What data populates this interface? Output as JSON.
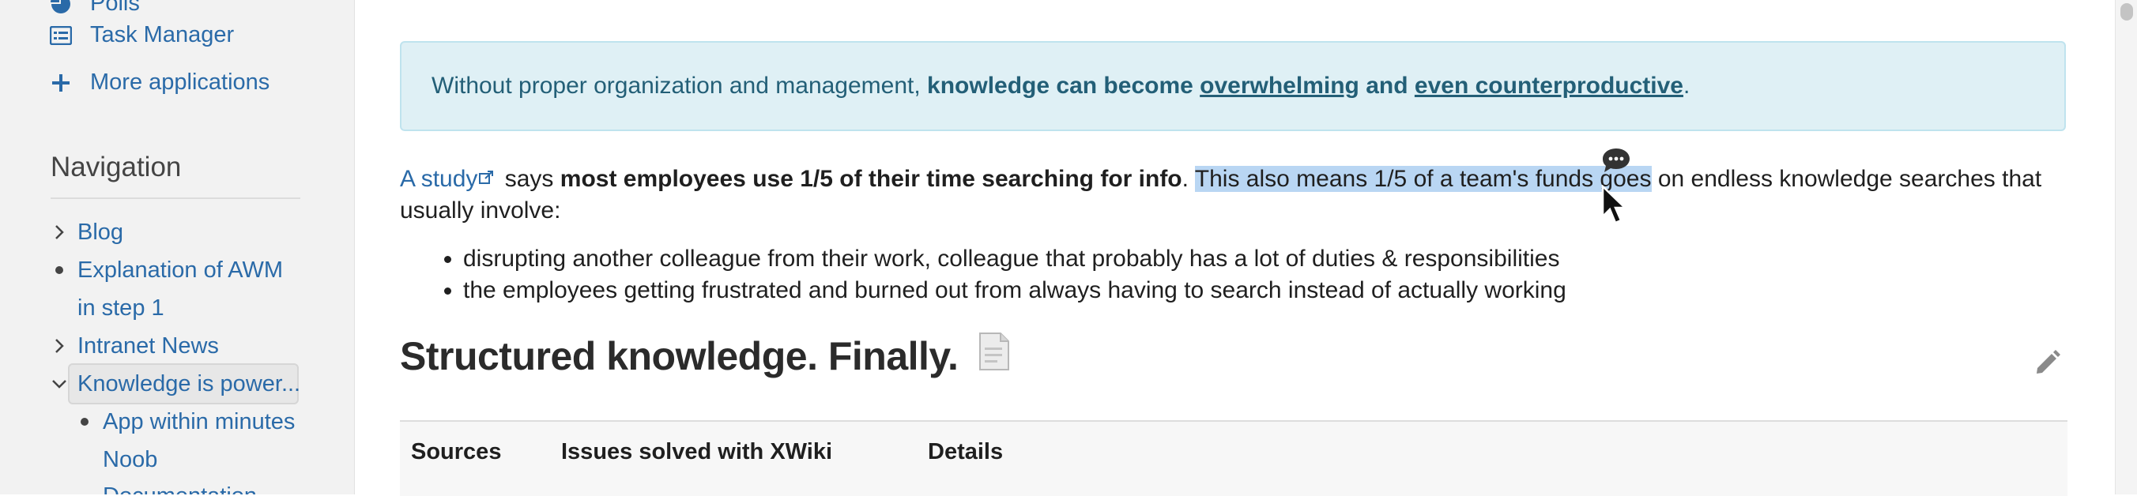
{
  "sidebar": {
    "apps": [
      {
        "label": "Polls",
        "icon": "pie-chart-icon"
      },
      {
        "label": "Task Manager",
        "icon": "list-icon"
      }
    ],
    "more_apps": {
      "label": "More applications",
      "icon": "plus-icon"
    },
    "nav_heading": "Navigation",
    "nav_items": {
      "blog": "Blog",
      "awm_line1": "Explanation of AWM",
      "awm_line2": "in step 1",
      "intranet_news": "Intranet News",
      "knowledge": "Knowledge is power...",
      "app_within": "App within minutes",
      "noob": "Noob",
      "documentation": "Documentation"
    }
  },
  "callout": {
    "text_plain": "Without proper organization and management, ",
    "text_bold": "knowledge can become ",
    "link1": "overwhelming",
    "and": " and ",
    "link2": "even counterproductive",
    "end": "."
  },
  "paragraph": {
    "link": "A study",
    "says": " says ",
    "bold": "most employees use 1/5 of their time searching for info",
    "period": ". ",
    "highlighted": "This also means 1/5 of a team's funds goes",
    "rest": " on endless knowledge searches that usually involve:"
  },
  "bullets": [
    "disrupting another colleague from their work, colleague that probably has a lot of duties & responsibilities",
    "the employees getting frustrated and burned out from always having to search instead of actually working"
  ],
  "section": {
    "title": "Structured knowledge. Finally."
  },
  "table": {
    "headers": [
      "Sources",
      "Issues solved with XWiki",
      "Details"
    ]
  },
  "colors": {
    "link": "#2a6aa8",
    "callout_bg": "#dff0f5",
    "highlight": "#b9d6f3"
  }
}
